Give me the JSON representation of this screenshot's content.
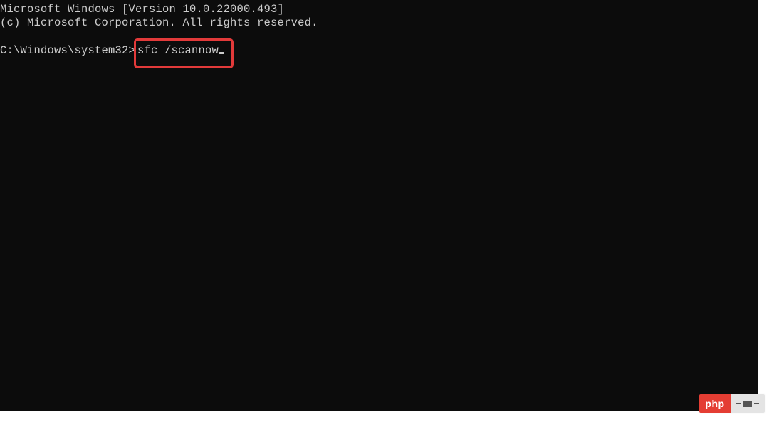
{
  "terminal": {
    "header_lines": [
      "Microsoft Windows [Version 10.0.22000.493]",
      "(c) Microsoft Corporation. All rights reserved."
    ],
    "prompt": "C:\\Windows\\system32>",
    "command": "sfc /scannow"
  },
  "watermark": {
    "left_text": "php"
  }
}
